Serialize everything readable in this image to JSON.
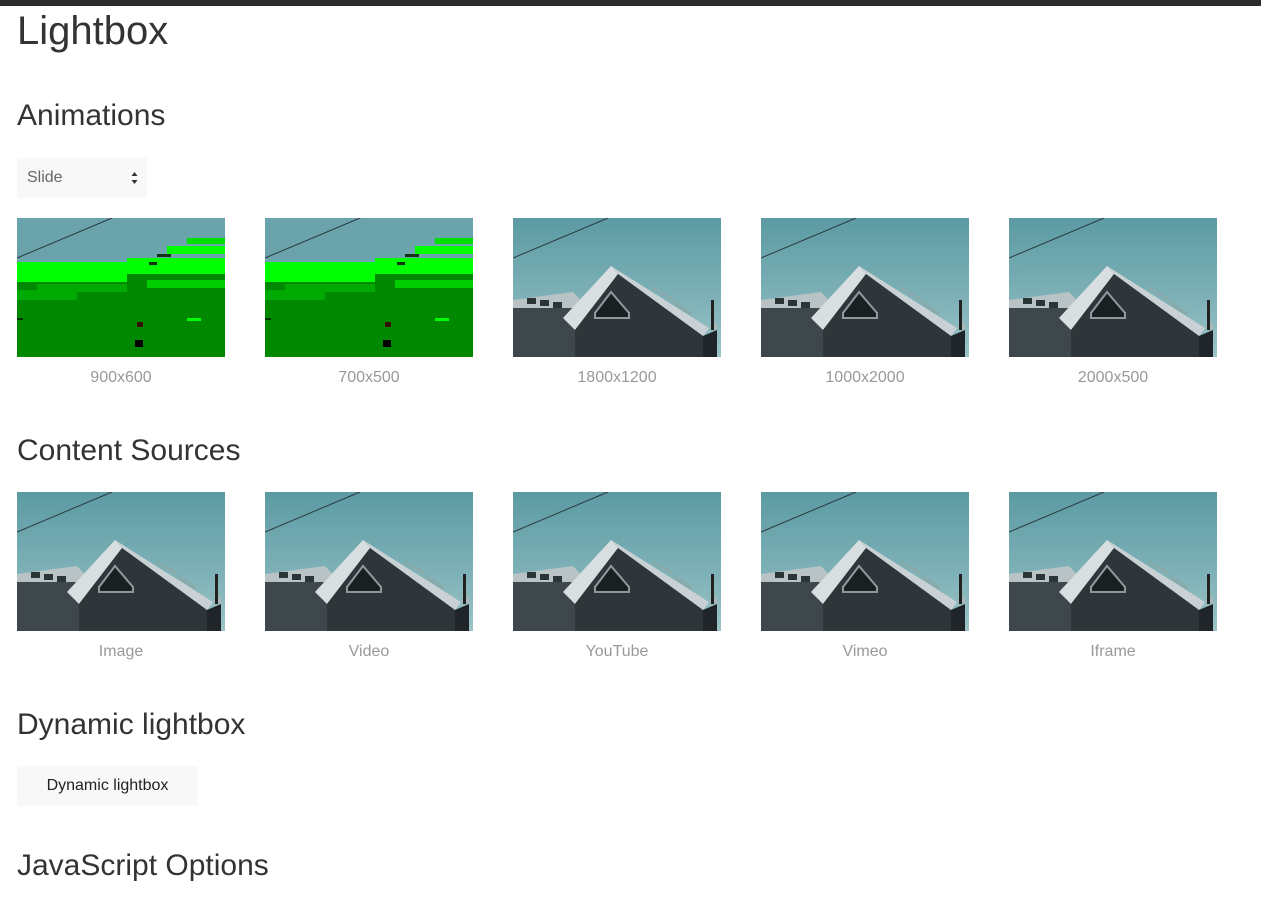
{
  "page": {
    "title": "Lightbox"
  },
  "sections": {
    "animations": "Animations",
    "content_sources": "Content Sources",
    "dynamic": "Dynamic lightbox",
    "js_options": "JavaScript Options"
  },
  "animation_select": {
    "value": "Slide"
  },
  "animation_items": [
    {
      "caption": "900x600",
      "variant": "glitch"
    },
    {
      "caption": "700x500",
      "variant": "glitch"
    },
    {
      "caption": "1800x1200",
      "variant": "photo"
    },
    {
      "caption": "1000x2000",
      "variant": "photo"
    },
    {
      "caption": "2000x500",
      "variant": "photo"
    }
  ],
  "content_items": [
    {
      "caption": "Image",
      "variant": "photo"
    },
    {
      "caption": "Video",
      "variant": "photo"
    },
    {
      "caption": "YouTube",
      "variant": "photo"
    },
    {
      "caption": "Vimeo",
      "variant": "photo"
    },
    {
      "caption": "Iframe",
      "variant": "photo"
    }
  ],
  "dynamic_button": {
    "label": "Dynamic lightbox"
  },
  "colors": {
    "topbar": "#2c2c2c",
    "heading": "#333333",
    "caption": "#999999",
    "control_bg": "#f8f8f8",
    "sky": "#6aa3ab",
    "glitch_green": "#008800",
    "glitch_lime": "#00ff00"
  }
}
